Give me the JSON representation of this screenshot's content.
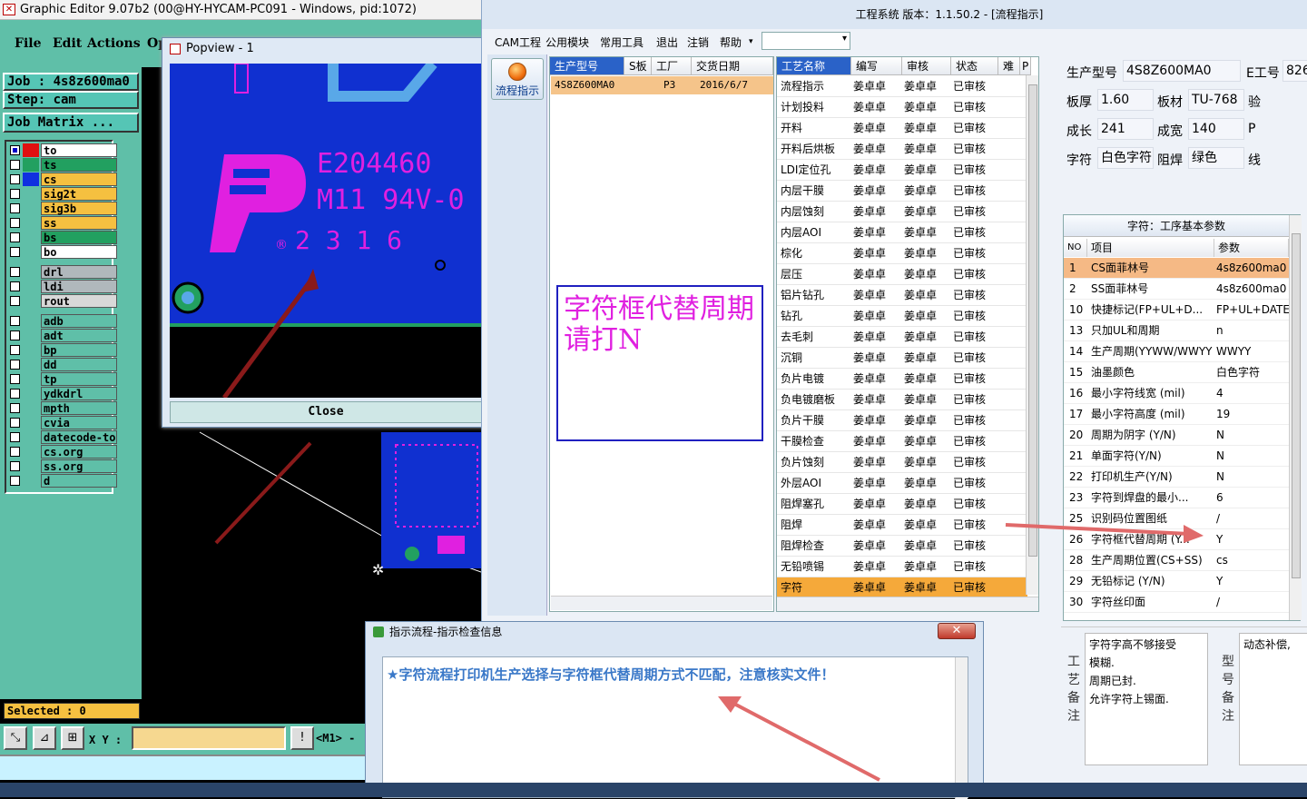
{
  "graphic_editor": {
    "title": "Graphic Editor 9.07b2 (00@HY-HYCAM-PC091 - Windows, pid:1072)",
    "menu": [
      "File",
      "Edit",
      "Actions",
      "Op"
    ],
    "job_label": "Job : 4s8z600ma0",
    "step_label": "Step: cam",
    "job_matrix": "Job Matrix ...",
    "layers": [
      {
        "name": "to",
        "color": "#ffffff",
        "swatch": "#e01010",
        "checked": true
      },
      {
        "name": "ts",
        "color": "#22a060",
        "swatch": "#22a060",
        "checked": false
      },
      {
        "name": "cs",
        "color": "#f5c040",
        "swatch": "#1030e0",
        "checked": false
      },
      {
        "name": "sig2t",
        "color": "#f5c040",
        "swatch": "#5fbfa8",
        "checked": false
      },
      {
        "name": "sig3b",
        "color": "#f5c040",
        "swatch": "#5fbfa8",
        "checked": false
      },
      {
        "name": "ss",
        "color": "#f5c040",
        "swatch": "#5fbfa8",
        "checked": false
      },
      {
        "name": "bs",
        "color": "#22a060",
        "swatch": "#5fbfa8",
        "checked": false
      },
      {
        "name": "bo",
        "color": "#ffffff",
        "swatch": "#5fbfa8",
        "checked": false
      },
      {
        "name": "drl",
        "color": "#b0b8bc",
        "swatch": "#5fbfa8",
        "checked": false
      },
      {
        "name": "ldi",
        "color": "#b0b8bc",
        "swatch": "#5fbfa8",
        "checked": false
      },
      {
        "name": "rout",
        "color": "#d8d8d8",
        "swatch": "#5fbfa8",
        "checked": false
      },
      {
        "name": "adb",
        "color": "#5fbfa8",
        "swatch": "#5fbfa8",
        "checked": false
      },
      {
        "name": "adt",
        "color": "#5fbfa8",
        "swatch": "#5fbfa8",
        "checked": false
      },
      {
        "name": "bp",
        "color": "#5fbfa8",
        "swatch": "#5fbfa8",
        "checked": false
      },
      {
        "name": "dd",
        "color": "#5fbfa8",
        "swatch": "#5fbfa8",
        "checked": false
      },
      {
        "name": "tp",
        "color": "#5fbfa8",
        "swatch": "#5fbfa8",
        "checked": false
      },
      {
        "name": "ydkdrl",
        "color": "#5fbfa8",
        "swatch": "#5fbfa8",
        "checked": false
      },
      {
        "name": "mpth",
        "color": "#5fbfa8",
        "swatch": "#5fbfa8",
        "checked": false
      },
      {
        "name": "cvia",
        "color": "#5fbfa8",
        "swatch": "#5fbfa8",
        "checked": false
      },
      {
        "name": "datecode-to",
        "color": "#5fbfa8",
        "swatch": "#5fbfa8",
        "checked": false
      },
      {
        "name": "cs.org",
        "color": "#5fbfa8",
        "swatch": "#5fbfa8",
        "checked": false
      },
      {
        "name": "ss.org",
        "color": "#5fbfa8",
        "swatch": "#5fbfa8",
        "checked": false
      },
      {
        "name": "d",
        "color": "#5fbfa8",
        "swatch": "#5fbfa8",
        "checked": false
      }
    ],
    "selected": "Selected : 0",
    "xy_label": "X Y :",
    "m1": "<M1> -"
  },
  "popview": {
    "title": "Popview - 1",
    "close_label": "Close",
    "pcb_text_line1": "E204460",
    "pcb_text_line2": "M11 94V-0",
    "pcb_text_line3": "2 3 1 6",
    "pcb_text_mark": "®"
  },
  "cam": {
    "title": "工程系统   版本：1.1.50.2 - [流程指示]",
    "menu": [
      "CAM工程",
      "公用模块",
      "常用工具",
      "退出",
      "注销",
      "帮助"
    ],
    "side_button": "流程指示",
    "prod_headers": [
      "生产型号",
      "S板",
      "工厂",
      "交货日期"
    ],
    "prod_row": {
      "model": "4S8Z600MA0",
      "factory": "P3",
      "date": "2016/6/7"
    },
    "note_text": "字符框代替周期请打N",
    "proc_headers": [
      "工艺名称",
      "编写",
      "审核",
      "状态",
      "难",
      "P"
    ],
    "processes": [
      [
        "流程指示",
        "姜卓卓",
        "姜卓卓",
        "已审核"
      ],
      [
        "计划投料",
        "姜卓卓",
        "姜卓卓",
        "已审核"
      ],
      [
        "开料",
        "姜卓卓",
        "姜卓卓",
        "已审核"
      ],
      [
        "开料后烘板",
        "姜卓卓",
        "姜卓卓",
        "已审核"
      ],
      [
        "LDI定位孔",
        "姜卓卓",
        "姜卓卓",
        "已审核"
      ],
      [
        "内层干膜",
        "姜卓卓",
        "姜卓卓",
        "已审核"
      ],
      [
        "内层蚀刻",
        "姜卓卓",
        "姜卓卓",
        "已审核"
      ],
      [
        "内层AOI",
        "姜卓卓",
        "姜卓卓",
        "已审核"
      ],
      [
        "棕化",
        "姜卓卓",
        "姜卓卓",
        "已审核"
      ],
      [
        "层压",
        "姜卓卓",
        "姜卓卓",
        "已审核"
      ],
      [
        "铝片钻孔",
        "姜卓卓",
        "姜卓卓",
        "已审核"
      ],
      [
        "钻孔",
        "姜卓卓",
        "姜卓卓",
        "已审核"
      ],
      [
        "去毛刺",
        "姜卓卓",
        "姜卓卓",
        "已审核"
      ],
      [
        "沉铜",
        "姜卓卓",
        "姜卓卓",
        "已审核"
      ],
      [
        "负片电镀",
        "姜卓卓",
        "姜卓卓",
        "已审核"
      ],
      [
        "负电镀磨板",
        "姜卓卓",
        "姜卓卓",
        "已审核"
      ],
      [
        "负片干膜",
        "姜卓卓",
        "姜卓卓",
        "已审核"
      ],
      [
        "干膜检查",
        "姜卓卓",
        "姜卓卓",
        "已审核"
      ],
      [
        "负片蚀刻",
        "姜卓卓",
        "姜卓卓",
        "已审核"
      ],
      [
        "外层AOI",
        "姜卓卓",
        "姜卓卓",
        "已审核"
      ],
      [
        "阻焊塞孔",
        "姜卓卓",
        "姜卓卓",
        "已审核"
      ],
      [
        "阻焊",
        "姜卓卓",
        "姜卓卓",
        "已审核"
      ],
      [
        "阻焊检查",
        "姜卓卓",
        "姜卓卓",
        "已审核"
      ],
      [
        "无铅喷锡",
        "姜卓卓",
        "姜卓卓",
        "已审核"
      ],
      [
        "字符",
        "姜卓卓",
        "姜卓卓",
        "已审核"
      ]
    ],
    "info": {
      "model_label": "生产型号",
      "model_value": "4S8Z600MA0",
      "eno_label": "E工号",
      "eno_value": "826",
      "thick_label": "板厚",
      "thick_value": "1.60",
      "mat_label": "板材",
      "mat_value": "TU-768",
      "ver_label": "验",
      "len_label": "成长",
      "len_value": "241",
      "wid_label": "成宽",
      "wid_value": "140",
      "p_label": "P",
      "char_label": "字符",
      "char_value": "白色字符",
      "mask_label": "阻焊",
      "mask_value": "绿色",
      "line_label": "线"
    },
    "param_title": "字符：工序基本参数",
    "param_headers": [
      "NO",
      "项目",
      "参数"
    ],
    "params": [
      [
        "1",
        "CS面菲林号",
        "4s8z600ma0"
      ],
      [
        "2",
        "SS面菲林号",
        "4s8z600ma0"
      ],
      [
        "10",
        "快捷标记(FP+UL+D...",
        "FP+UL+DATE"
      ],
      [
        "13",
        "只加UL和周期",
        "n"
      ],
      [
        "14",
        "生产周期(YYWW/WWYY)",
        "WWYY"
      ],
      [
        "15",
        "油墨颜色",
        "白色字符"
      ],
      [
        "16",
        "最小字符线宽 (mil)",
        "4"
      ],
      [
        "17",
        "最小字符高度 (mil)",
        "19"
      ],
      [
        "20",
        "周期为阴字 (Y/N)",
        "N"
      ],
      [
        "21",
        "单面字符(Y/N)",
        "N"
      ],
      [
        "22",
        "打印机生产(Y/N)",
        "N"
      ],
      [
        "23",
        "字符到焊盘的最小...",
        "6"
      ],
      [
        "25",
        "识别码位置图纸",
        "/"
      ],
      [
        "26",
        "字符框代替周期 (Y...",
        "Y"
      ],
      [
        "28",
        "生产周期位置(CS+SS)",
        "cs"
      ],
      [
        "29",
        "无铅标记 (Y/N)",
        "Y"
      ],
      [
        "30",
        "字符丝印面",
        "/"
      ]
    ],
    "remark_label": "工艺备注",
    "remark_text": [
      "字符字高不够接受",
      "模糊.",
      "周期已封.",
      "允许字符上锡面."
    ],
    "model_remark_label": "型号备注",
    "model_remark_text": "动态补偿,"
  },
  "dialog": {
    "title": "指示流程-指示检查信息",
    "close_label": "✕",
    "message": "★字符流程打印机生产选择与字符框代替周期方式不匹配，注意核实文件！"
  }
}
